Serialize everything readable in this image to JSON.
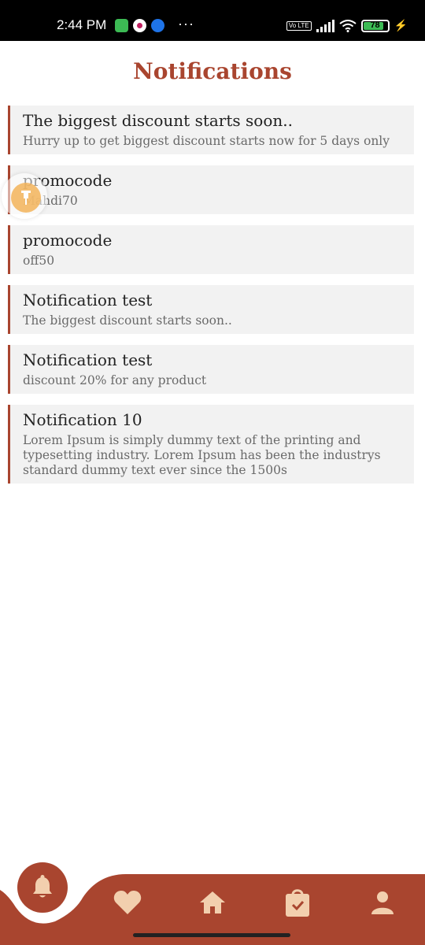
{
  "status_bar": {
    "time": "2:44 PM",
    "more": "···",
    "volte": "Vo LTE",
    "battery": "78",
    "charging_icon": "bolt-icon"
  },
  "header": {
    "title": "Notifications"
  },
  "notifications": [
    {
      "title": "The biggest discount starts soon..",
      "body": "Hurry up to get biggest discount starts now for 5 days only"
    },
    {
      "title": "promocode",
      "body": "Mahdi70"
    },
    {
      "title": "promocode",
      "body": "off50"
    },
    {
      "title": "Notification test",
      "body": "The biggest discount starts soon.."
    },
    {
      "title": "Notification test",
      "body": "discount 20% for any product"
    },
    {
      "title": "Notification 10",
      "body": "Lorem Ipsum is simply dummy text of the printing and typesetting industry. Lorem Ipsum has been the industrys standard dummy text ever since the 1500s"
    }
  ],
  "bottom_nav": {
    "items": [
      {
        "icon": "bell-icon",
        "active": true
      },
      {
        "icon": "heart-icon",
        "active": false
      },
      {
        "icon": "home-icon",
        "active": false
      },
      {
        "icon": "shopping-bag-icon",
        "active": false
      },
      {
        "icon": "user-icon",
        "active": false
      }
    ]
  },
  "colors": {
    "accent": "#a9452f",
    "icon_fill": "#f2cfae",
    "card_bg": "#f2f2f2",
    "floating_bubble": "#f3b45a"
  }
}
